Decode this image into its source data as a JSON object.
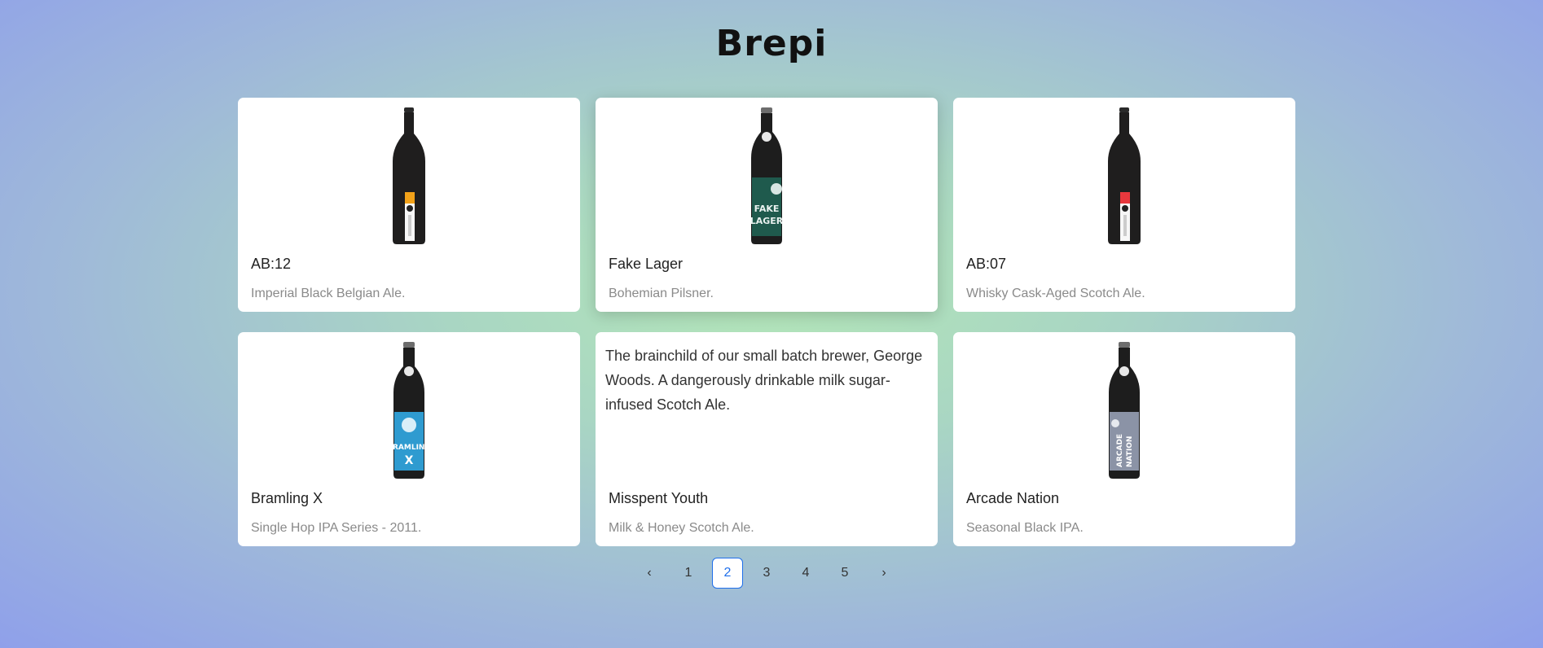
{
  "app": {
    "title": "Brepi"
  },
  "cards": [
    {
      "name": "AB:12",
      "description": "Imperial Black Belgian Ale.",
      "bottle_style": "tall-black",
      "label_color": "#f2a219",
      "image_alt": "AB:12 bottle"
    },
    {
      "name": "Fake Lager",
      "description": "Bohemian Pilsner.",
      "bottle_style": "punk",
      "label_color": "#1f5a4d",
      "label_text": "FAKE LAGER",
      "image_alt": "Fake Lager bottle"
    },
    {
      "name": "AB:07",
      "description": "Whisky Cask-Aged Scotch Ale.",
      "bottle_style": "tall-black",
      "label_color": "#e8383d",
      "image_alt": "AB:07 bottle"
    },
    {
      "name": "Bramling X",
      "description": "Single Hop IPA Series - 2011.",
      "bottle_style": "punk",
      "label_color": "#2f9bd0",
      "label_text": "BRAMLING X",
      "image_alt": "Bramling X bottle"
    },
    {
      "name": "Misspent Youth",
      "description": "Milk & Honey Scotch Ale.",
      "overlay_text": "The brainchild of our small batch brewer, George Woods. A dangerously drinkable milk sugar- infused Scotch Ale.",
      "bottle_style": "none"
    },
    {
      "name": "Arcade Nation",
      "description": "Seasonal Black IPA.",
      "bottle_style": "punk",
      "label_color": "#8b93a6",
      "label_text": "ARCADE NATION",
      "image_alt": "Arcade Nation bottle"
    }
  ],
  "pagination": {
    "prev_label": "‹",
    "next_label": "›",
    "pages": [
      "1",
      "2",
      "3",
      "4",
      "5"
    ],
    "current": "2"
  },
  "colors": {
    "accent": "#1f6feb",
    "bg_center": "#b3e6b8",
    "bg_edge": "#8fa0ea",
    "card_bg": "#ffffff",
    "desc_text": "#8a8a8a"
  }
}
